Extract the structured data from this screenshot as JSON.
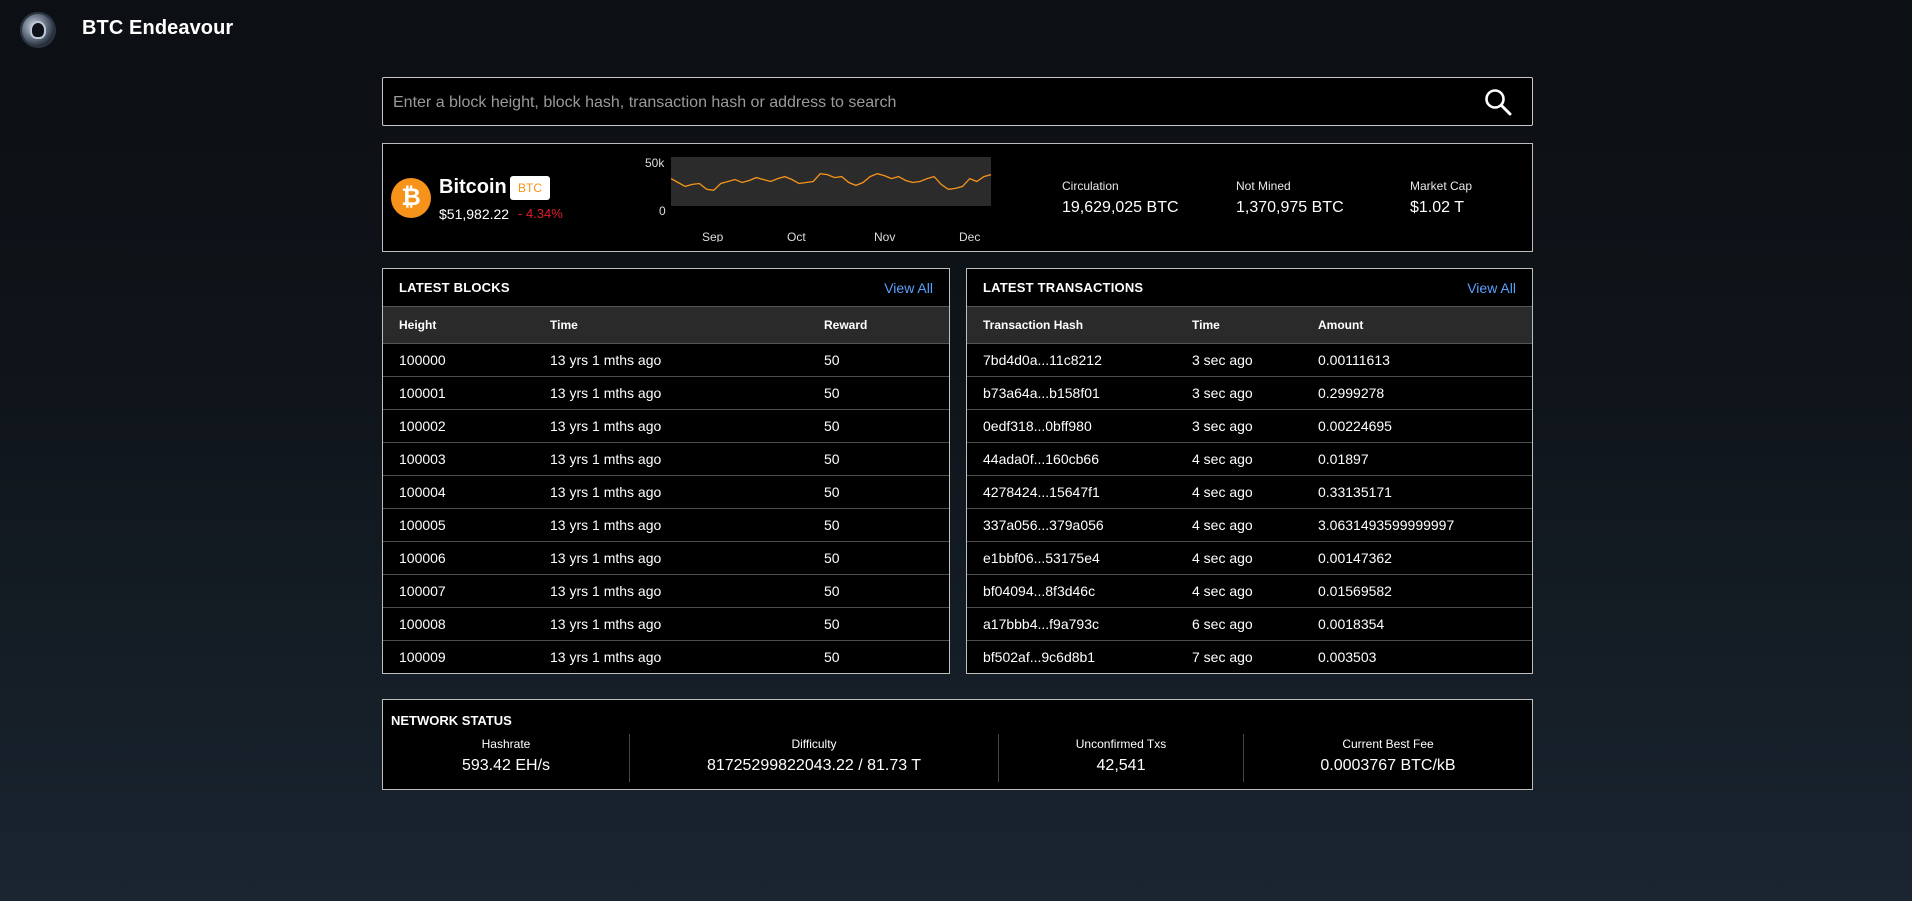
{
  "app": {
    "title": "BTC Endeavour"
  },
  "search": {
    "placeholder": "Enter a block height, block hash, transaction hash or address to search"
  },
  "coin": {
    "name": "Bitcoin",
    "symbol": "BTC",
    "price": "$51,982.22",
    "change": "- 4.34%",
    "chart": {
      "y_ticks": [
        "50k",
        "0"
      ],
      "x_ticks": [
        "Sep",
        "Oct",
        "Nov",
        "Dec"
      ],
      "line_color": "#f7931a",
      "values": [
        28,
        24,
        20,
        22,
        23,
        17,
        16,
        23,
        25,
        27,
        24,
        26,
        29,
        27,
        25,
        28,
        30,
        27,
        23,
        24,
        25,
        33,
        32,
        29,
        30,
        24,
        21,
        24,
        30,
        33,
        31,
        28,
        30,
        26,
        24,
        25,
        28,
        30,
        22,
        17,
        18,
        20,
        28,
        25,
        30,
        32
      ]
    }
  },
  "stats": [
    {
      "label": "Circulation",
      "value": "19,629,025 BTC"
    },
    {
      "label": "Not Mined",
      "value": "1,370,975 BTC"
    },
    {
      "label": "Market Cap",
      "value": "$1.02 T"
    }
  ],
  "blocks": {
    "title": "LATEST BLOCKS",
    "view_all": "View All",
    "columns": [
      "Height",
      "Time",
      "Reward"
    ],
    "rows": [
      [
        "100000",
        "13 yrs 1 mths ago",
        "50"
      ],
      [
        "100001",
        "13 yrs 1 mths ago",
        "50"
      ],
      [
        "100002",
        "13 yrs 1 mths ago",
        "50"
      ],
      [
        "100003",
        "13 yrs 1 mths ago",
        "50"
      ],
      [
        "100004",
        "13 yrs 1 mths ago",
        "50"
      ],
      [
        "100005",
        "13 yrs 1 mths ago",
        "50"
      ],
      [
        "100006",
        "13 yrs 1 mths ago",
        "50"
      ],
      [
        "100007",
        "13 yrs 1 mths ago",
        "50"
      ],
      [
        "100008",
        "13 yrs 1 mths ago",
        "50"
      ],
      [
        "100009",
        "13 yrs 1 mths ago",
        "50"
      ]
    ]
  },
  "transactions": {
    "title": "LATEST TRANSACTIONS",
    "view_all": "View All",
    "columns": [
      "Transaction Hash",
      "Time",
      "Amount"
    ],
    "rows": [
      [
        "7bd4d0a...11c8212",
        "3 sec ago",
        "0.00111613"
      ],
      [
        "b73a64a...b158f01",
        "3 sec ago",
        "0.2999278"
      ],
      [
        "0edf318...0bff980",
        "3 sec ago",
        "0.00224695"
      ],
      [
        "44ada0f...160cb66",
        "4 sec ago",
        "0.01897"
      ],
      [
        "4278424...15647f1",
        "4 sec ago",
        "0.33135171"
      ],
      [
        "337a056...379a056",
        "4 sec ago",
        "3.0631493599999997"
      ],
      [
        "e1bbf06...53175e4",
        "4 sec ago",
        "0.00147362"
      ],
      [
        "bf04094...8f3d46c",
        "4 sec ago",
        "0.01569582"
      ],
      [
        "a17bbb4...f9a793c",
        "6 sec ago",
        "0.0018354"
      ],
      [
        "bf502af...9c6d8b1",
        "7 sec ago",
        "0.003503"
      ]
    ]
  },
  "network": {
    "title": "NETWORK STATUS",
    "items": [
      {
        "label": "Hashrate",
        "value": "593.42 EH/s"
      },
      {
        "label": "Difficulty",
        "value": "81725299822043.22 / 81.73 T"
      },
      {
        "label": "Unconfirmed Txs",
        "value": "42,541"
      },
      {
        "label": "Current Best Fee",
        "value": "0.0003767 BTC/kB"
      }
    ]
  }
}
